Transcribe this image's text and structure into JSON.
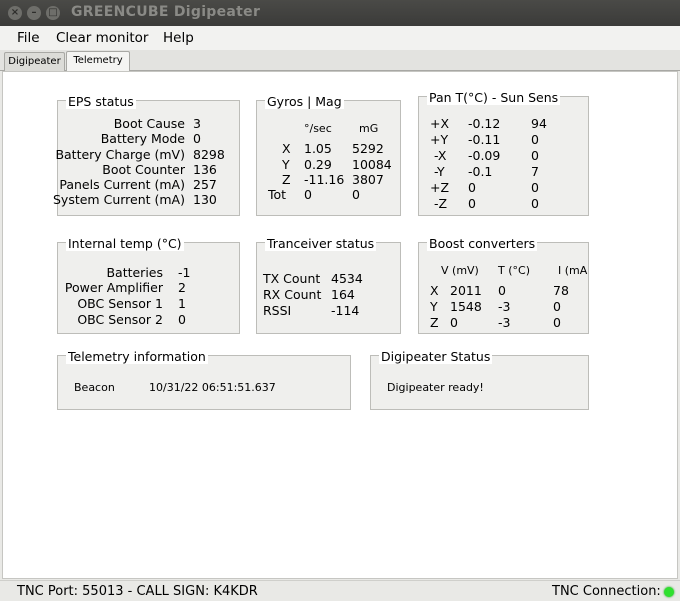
{
  "window": {
    "title": "GREENCUBE Digipeater"
  },
  "menu": {
    "file": "File",
    "clear_monitor": "Clear monitor",
    "help": "Help"
  },
  "tabs": {
    "digipeater": "Digipeater",
    "telemetry": "Telemetry"
  },
  "eps": {
    "title": "EPS status",
    "rows": [
      {
        "label": "Boot Cause",
        "value": "3"
      },
      {
        "label": "Battery Mode",
        "value": "0"
      },
      {
        "label": "Battery Charge (mV)",
        "value": "8298"
      },
      {
        "label": "Boot Counter",
        "value": "136"
      },
      {
        "label": "Panels Current (mA)",
        "value": "257"
      },
      {
        "label": "System Current (mA)",
        "value": "130"
      }
    ]
  },
  "gyros": {
    "title": "Gyros |  Mag",
    "headers": {
      "gyro": "°/sec",
      "mag": "mG"
    },
    "rows": [
      {
        "axis": "X",
        "gyro": "1.05",
        "mag": "5292"
      },
      {
        "axis": "Y",
        "gyro": "0.29",
        "mag": "10084"
      },
      {
        "axis": "Z",
        "gyro": "-11.16",
        "mag": "3807"
      },
      {
        "axis": "Tot",
        "gyro": "0",
        "mag": "0"
      }
    ]
  },
  "pan": {
    "title": "Pan T(°C) - Sun Sens",
    "rows": [
      {
        "axis": "+X",
        "temp": "-0.12",
        "sun": "94"
      },
      {
        "axis": "+Y",
        "temp": "-0.11",
        "sun": "0"
      },
      {
        "axis": "-X",
        "temp": "-0.09",
        "sun": "0"
      },
      {
        "axis": "-Y",
        "temp": "-0.1",
        "sun": "7"
      },
      {
        "axis": "+Z",
        "temp": "0",
        "sun": "0"
      },
      {
        "axis": "-Z",
        "temp": "0",
        "sun": "0"
      }
    ]
  },
  "internal_temp": {
    "title": "Internal temp (°C)",
    "rows": [
      {
        "label": "Batteries",
        "value": "-1"
      },
      {
        "label": "Power Amplifier",
        "value": "2"
      },
      {
        "label": "OBC Sensor 1",
        "value": "1"
      },
      {
        "label": "OBC Sensor 2",
        "value": "0"
      }
    ]
  },
  "transceiver": {
    "title": "Tranceiver status",
    "rows": [
      {
        "label": "TX Count",
        "value": "4534"
      },
      {
        "label": "RX Count",
        "value": "164"
      },
      {
        "label": "RSSI",
        "value": "-114"
      }
    ]
  },
  "boost": {
    "title": "Boost converters",
    "headers": {
      "v": "V (mV)",
      "t": "T (°C)",
      "i": "I (mA"
    },
    "rows": [
      {
        "axis": "X",
        "v": "2011",
        "t": "0",
        "i": "78"
      },
      {
        "axis": "Y",
        "v": "1548",
        "t": "-3",
        "i": "0"
      },
      {
        "axis": "Z",
        "v": "0",
        "t": "-3",
        "i": "0"
      }
    ]
  },
  "telemetry_info": {
    "title": "Telemetry information",
    "label": "Beacon",
    "value": "10/31/22 06:51:51.637"
  },
  "digi_status": {
    "title": "Digipeater Status",
    "message": "Digipeater ready!"
  },
  "status": {
    "port": "TNC Port: 55013 - CALL SIGN: K4KDR",
    "connection": "TNC Connection:"
  },
  "colors": {
    "connection_led": "#2fe02f"
  }
}
